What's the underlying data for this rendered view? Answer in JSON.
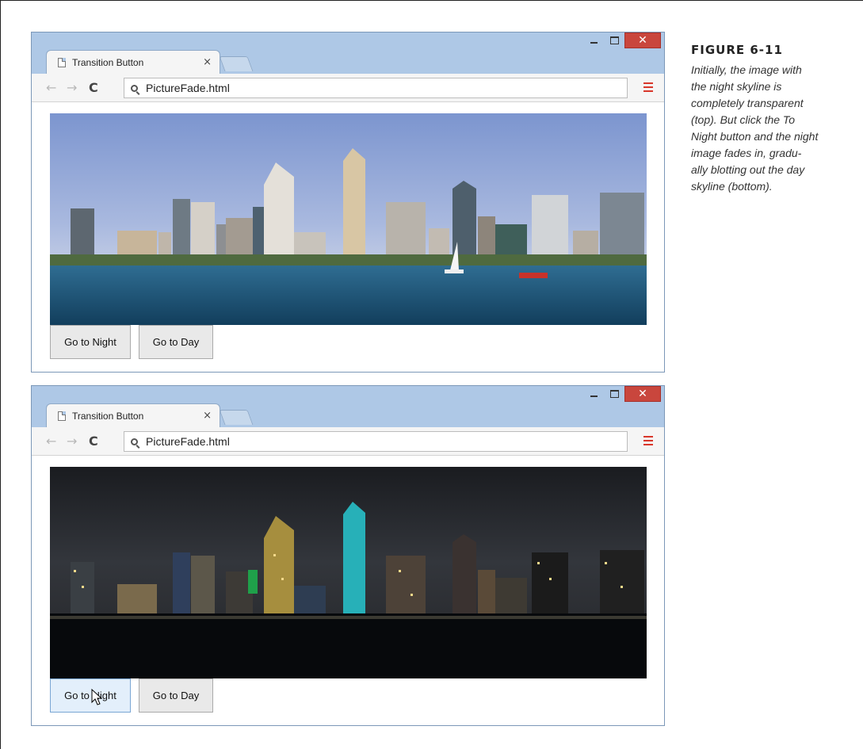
{
  "figure": {
    "label": "FIGURE 6-11",
    "caption": "Initially, the image with\nthe night skyline is\ncompletely transparent\n(top). But click the To\nNight button and the night\nimage fades in, gradu-\nally blotting out the day\nskyline (bottom)."
  },
  "windows": [
    {
      "state": "day",
      "tab_title": "Transition Button",
      "tab_close": "×",
      "url": "PictureFade.html",
      "buttons": {
        "night": "Go to Night",
        "day": "Go to Day"
      }
    },
    {
      "state": "night",
      "tab_title": "Transition Button",
      "tab_close": "×",
      "url": "PictureFade.html",
      "buttons": {
        "night": "Go to Night",
        "day": "Go to Day"
      }
    }
  ],
  "icons": {
    "back": "back-arrow-icon",
    "forward": "forward-arrow-icon",
    "reload": "reload-icon",
    "search": "search-icon",
    "menu": "hamburger-menu-icon",
    "page": "page-icon",
    "cursor": "mouse-pointer-icon"
  },
  "colors": {
    "window_frame": "#aec8e6",
    "close_button": "#c9463d",
    "menu_icon": "#d8362a"
  }
}
